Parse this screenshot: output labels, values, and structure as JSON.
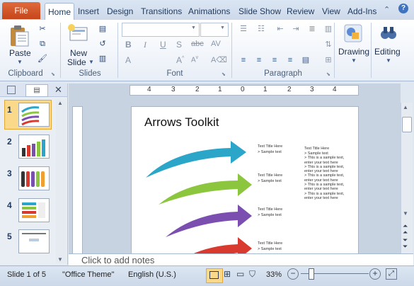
{
  "tabs": {
    "file": "File",
    "items": [
      "Home",
      "Insert",
      "Design",
      "Transitions",
      "Animations",
      "Slide Show",
      "Review",
      "View",
      "Add-Ins"
    ]
  },
  "ribbon": {
    "clipboard": {
      "paste": "Paste",
      "label": "Clipboard"
    },
    "slides": {
      "new_slide_1": "New",
      "new_slide_2": "Slide",
      "label": "Slides"
    },
    "font": {
      "label": "Font"
    },
    "paragraph": {
      "label": "Paragraph"
    },
    "drawing": {
      "label": "Drawing"
    },
    "editing": {
      "label": "Editing"
    }
  },
  "ruler": {
    "ticks": [
      "4",
      "3",
      "2",
      "1",
      "0",
      "1",
      "2",
      "3",
      "4"
    ]
  },
  "thumbnails": [
    "1",
    "2",
    "3",
    "4",
    "5"
  ],
  "slide": {
    "title": "Arrows Toolkit",
    "block_title": "Text Title Here",
    "sample": "Sample text",
    "bullets": [
      "Sample text",
      "This is a sample text, enter your text here",
      "This is a sample text, enter your text here",
      "This is a sample text, enter your text here",
      "This is a sample text, enter your text here",
      "This is a sample text, enter your text here"
    ]
  },
  "notes": {
    "placeholder": "Click to add notes"
  },
  "status": {
    "slide": "Slide 1 of 5",
    "theme": "\"Office Theme\"",
    "language": "English (U.S.)",
    "zoom": "33%"
  },
  "colors": {
    "file_tab": "#d2572a",
    "arrow_blue": "#2ba6c9",
    "arrow_green": "#8cc63f",
    "arrow_purple": "#7b4fb0",
    "arrow_red": "#d93a2f",
    "accent": "#f7c25c"
  }
}
